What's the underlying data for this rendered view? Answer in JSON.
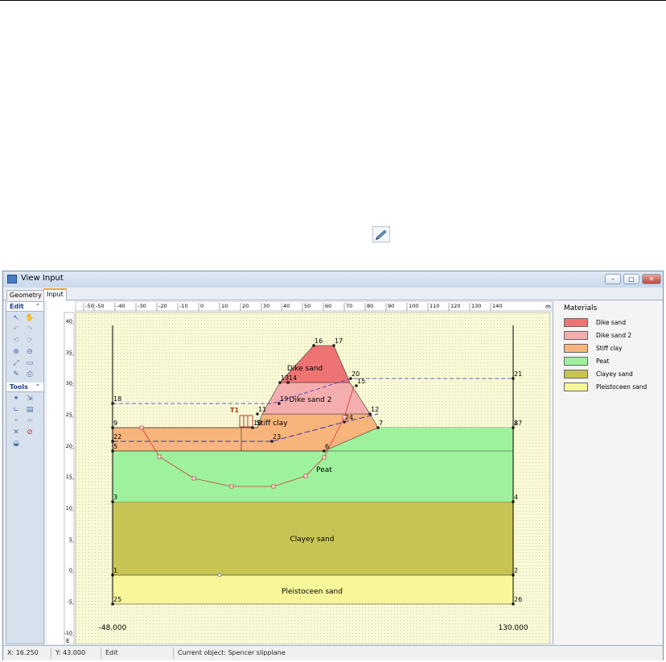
{
  "window": {
    "title": "View Input"
  },
  "tabs": [
    {
      "label": "Geometry"
    },
    {
      "label": "Input"
    }
  ],
  "toolbox": {
    "edit_label": "Edit",
    "tools_label": "Tools",
    "chevron": "⌃"
  },
  "window_buttons": {
    "minimize": "–",
    "maximize": "□",
    "close": "✕"
  },
  "ruler": {
    "unit": "m",
    "x_ticks": [
      "-50",
      "-50",
      "-40",
      "-30",
      "-20",
      "-10",
      "0",
      "10",
      "20",
      "30",
      "40",
      "50",
      "60",
      "70",
      "80",
      "90",
      "100",
      "110",
      "120",
      "130",
      "140"
    ],
    "y_ticks": [
      "40",
      "35",
      "30",
      "25",
      "20",
      "15",
      "10",
      "5",
      "0",
      "-5",
      "-10"
    ],
    "corner_label": "E"
  },
  "boundaries": {
    "left": "-48.000",
    "right": "130.000"
  },
  "layers": [
    {
      "name": "Dike sand",
      "color": "#ee7373"
    },
    {
      "name": "Dike sand 2",
      "color": "#f5aeae"
    },
    {
      "name": "Stiff clay",
      "color": "#f7b47b"
    },
    {
      "name": "Peat",
      "color": "#9ef29e"
    },
    {
      "name": "Clayey sand",
      "color": "#c7c453"
    },
    {
      "name": "Pleistoceen sand",
      "color": "#f7f79a"
    }
  ],
  "materials": {
    "title": "Materials",
    "items": [
      {
        "name": "Dike sand",
        "color": "#ee7373"
      },
      {
        "name": "Dike sand 2",
        "color": "#f5aeae"
      },
      {
        "name": "Stiff clay",
        "color": "#f7b47b"
      },
      {
        "name": "Peat",
        "color": "#9ef29e"
      },
      {
        "name": "Clayey sand",
        "color": "#c7c453"
      },
      {
        "name": "Pleistoceen sand",
        "color": "#f7f79a"
      }
    ]
  },
  "point_labels": [
    "1",
    "2",
    "3",
    "4",
    "5",
    "6",
    "7",
    "8",
    "9",
    "10",
    "11",
    "12",
    "13",
    "14",
    "15",
    "16",
    "17",
    "18",
    "19",
    "20",
    "21",
    "22",
    "23",
    "24",
    "25",
    "26",
    "27"
  ],
  "load_label": "T1",
  "status": {
    "x": "X: 16.250",
    "y": "Y: 43.000",
    "mode": "Edit",
    "current": "Current object: Spencer slipplane"
  }
}
